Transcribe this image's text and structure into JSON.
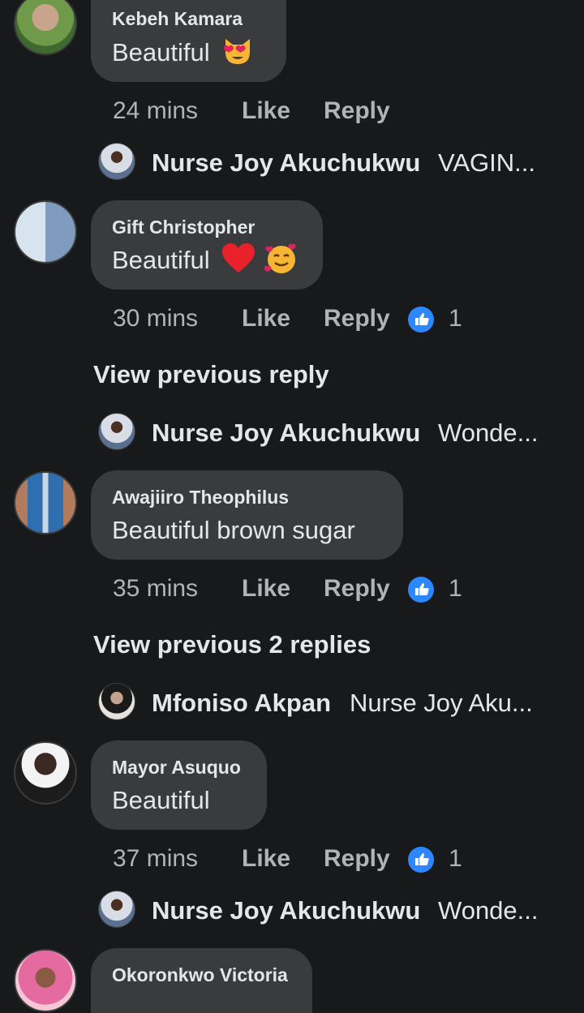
{
  "comments": [
    {
      "author": "Kebeh Kamara",
      "text": "Beautiful",
      "emoji": "heart-eyes-cat",
      "time": "24 mins",
      "like_label": "Like",
      "reply_label": "Reply",
      "reaction_count": "",
      "reply": {
        "name": "Nurse Joy Akuchukwu",
        "snippet": "VAGIN..."
      }
    },
    {
      "author": "Gift Christopher",
      "text": "Beautiful",
      "emoji": "heart + smiling-face-with-hearts",
      "time": "30 mins",
      "like_label": "Like",
      "reply_label": "Reply",
      "reaction_count": "1",
      "view_previous": "View previous reply",
      "reply": {
        "name": "Nurse Joy Akuchukwu",
        "snippet": "Wonde..."
      }
    },
    {
      "author": "Awajiiro Theophilus",
      "text": "Beautiful brown sugar",
      "time": "35 mins",
      "like_label": "Like",
      "reply_label": "Reply",
      "reaction_count": "1",
      "view_previous": "View previous 2 replies",
      "reply": {
        "name": "Mfoniso Akpan",
        "snippet": "Nurse Joy Aku..."
      }
    },
    {
      "author": "Mayor Asuquo",
      "text": "Beautiful",
      "time": "37 mins",
      "like_label": "Like",
      "reply_label": "Reply",
      "reaction_count": "1",
      "reply": {
        "name": "Nurse Joy Akuchukwu",
        "snippet": "Wonde..."
      }
    },
    {
      "author": "Okoronkwo Victoria"
    }
  ],
  "colors": {
    "background": "#18191a",
    "bubble": "#3a3b3c",
    "primary_text": "#e4e6eb",
    "secondary_text": "#b0b3b8",
    "like_blue": "#2d88ff"
  }
}
